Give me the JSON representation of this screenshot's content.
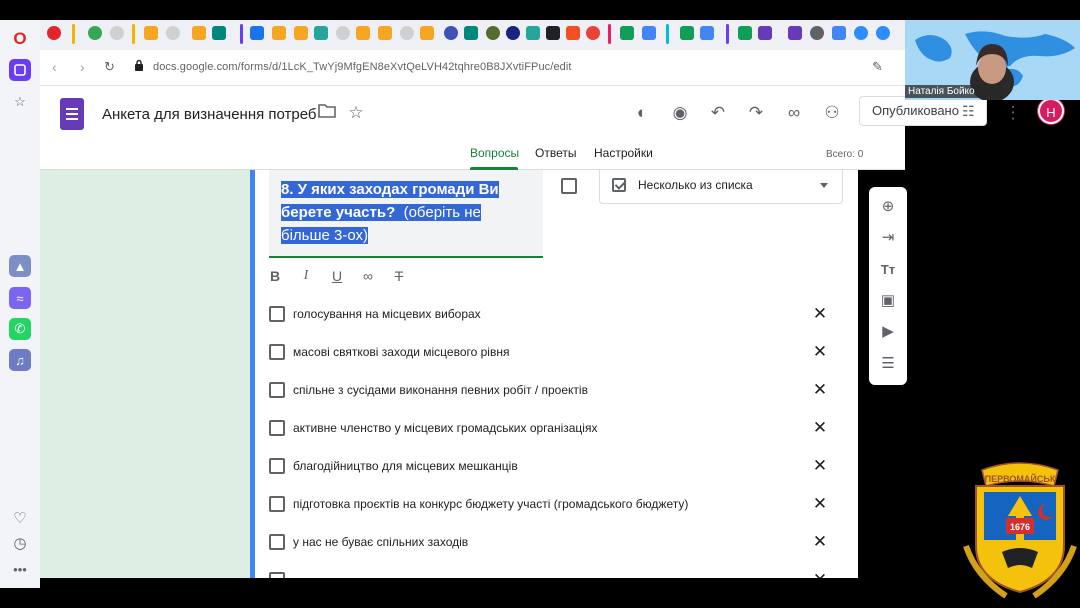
{
  "browser": {
    "url": "docs.google.com/forms/d/1LcK_TwYj9MfgEN8eXvtQeLVH42tqhre0B8JXvtiFPuc/edit"
  },
  "form": {
    "title": "Анкета для визначення потреб",
    "publish_label": "Опубликовано",
    "avatar_letter": "Н",
    "tabs": [
      {
        "label": "Вопросы",
        "active": true
      },
      {
        "label": "Ответы",
        "active": false
      },
      {
        "label": "Настройки",
        "active": false
      }
    ],
    "total_label": "Всего: 0"
  },
  "question": {
    "title_line1": "8. У яких заходах громади Ви",
    "title_line2a": "берете участь?",
    "title_line2b": "(оберіть не",
    "title_line3": "більше 3-ох)",
    "type_label": "Несколько из списка",
    "options": [
      "голосування на місцевих виборах",
      "масові святкові заходи місцевого рівня",
      "спільне з сусідами виконання певних робіт / проектів",
      "активне членство у місцевих громадських організаціях",
      "благодійництво для місцевих мешканців",
      "підготовка проєктів на конкурс бюджету участі (громадського бюджету)",
      "у нас не буває спільних заходів"
    ]
  },
  "video": {
    "participant_name": "Наталія Бойко"
  },
  "emblem": {
    "city_name": "ПЕРВОМАЙСЬК",
    "year": "1676"
  },
  "colors": {
    "forms_purple": "#673ab7",
    "active_green": "#188038",
    "card_accent": "#4285f4",
    "selection": "#3367d6",
    "bg_tint": "#dcefe2"
  }
}
